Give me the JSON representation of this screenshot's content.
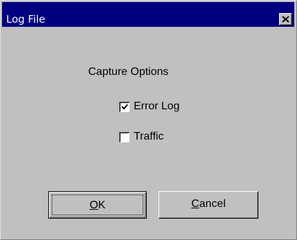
{
  "window": {
    "title": "Log File",
    "close_icon": "close-icon"
  },
  "capture_options": {
    "heading": "Capture Options",
    "options": [
      {
        "label": "Error Log",
        "checked": true
      },
      {
        "label": "Traffic",
        "checked": false
      }
    ]
  },
  "buttons": {
    "ok": {
      "mnemonic": "O",
      "rest": "K"
    },
    "cancel": {
      "mnemonic": "C",
      "rest": "ancel"
    }
  },
  "colors": {
    "titlebar": "#000080",
    "face": "#c0c0c0"
  }
}
